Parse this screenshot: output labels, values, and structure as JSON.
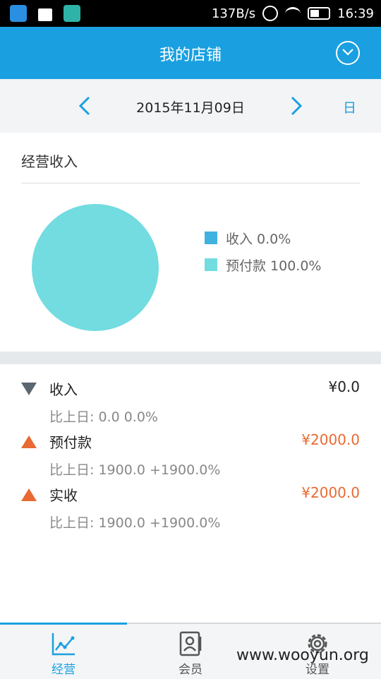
{
  "status_bar": {
    "network_speed": "137B/s",
    "time": "16:39"
  },
  "header": {
    "title": "我的店铺",
    "menu_icon": "chevron-down-circle-icon"
  },
  "date_nav": {
    "date": "2015年11月09日",
    "unit": "日",
    "prev_icon": "chevron-left-icon",
    "next_icon": "chevron-right-icon"
  },
  "section": {
    "title": "经营收入"
  },
  "chart_data": {
    "type": "pie",
    "slices": [
      {
        "label": "收入",
        "value": 0.0,
        "color": "#3fb2e0"
      },
      {
        "label": "预付款",
        "value": 100.0,
        "color": "#72dce0"
      }
    ],
    "legend": [
      {
        "label": "收入 0.0%",
        "color": "#3fb2e0"
      },
      {
        "label": "预付款 100.0%",
        "color": "#72dce0"
      }
    ]
  },
  "metrics": [
    {
      "label": "收入",
      "amount": "¥0.0",
      "compare": "比上日: 0.0 0.0%",
      "trend": "down",
      "amount_color": "#222222",
      "arrow_color": "#5b6670"
    },
    {
      "label": "预付款",
      "amount": "¥2000.0",
      "compare": "比上日: 1900.0 +1900.0%",
      "trend": "up",
      "amount_color": "#e86a32",
      "arrow_color": "#e86a32"
    },
    {
      "label": "实收",
      "amount": "¥2000.0",
      "compare": "比上日: 1900.0 +1900.0%",
      "trend": "up",
      "amount_color": "#e86a32",
      "arrow_color": "#e86a32"
    }
  ],
  "tabs": [
    {
      "label": "经营",
      "icon": "line-chart-icon",
      "active": true
    },
    {
      "label": "会员",
      "icon": "member-card-icon",
      "active": false
    },
    {
      "label": "设置",
      "icon": "gear-icon",
      "active": false
    }
  ],
  "watermark": "www.wooyun.org",
  "colors": {
    "accent": "#1aa0e0",
    "up": "#e86a32",
    "down": "#5b6670"
  }
}
